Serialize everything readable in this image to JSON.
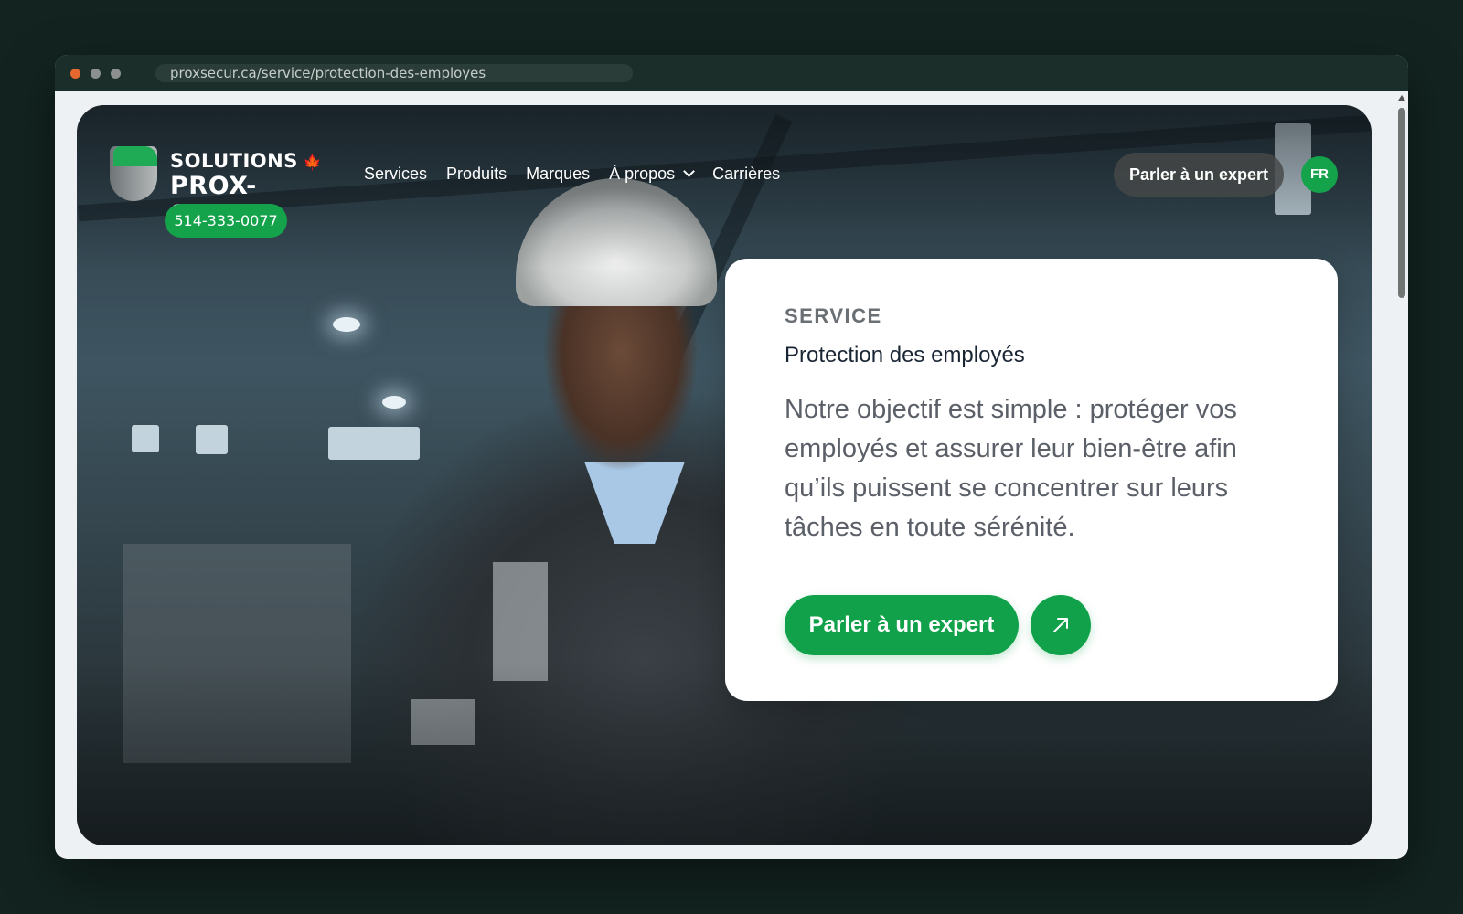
{
  "browser": {
    "url": "proxsecur.ca/service/protection-des-employes"
  },
  "header": {
    "logo_line1": "SOLUTIONS",
    "logo_line2": "PROX-SECUR",
    "phone": "514-333-0077",
    "nav": [
      {
        "label": "Services"
      },
      {
        "label": "Produits"
      },
      {
        "label": "Marques"
      },
      {
        "label": "À propos"
      },
      {
        "label": "Carrières"
      }
    ],
    "cta": "Parler à un expert",
    "lang": "FR"
  },
  "card": {
    "eyebrow": "SERVICE",
    "title": "Protection des employés",
    "body": "Notre objectif est simple : protéger vos employés et assurer leur bien-être afin qu’ils puissent se concentrer sur leurs tâches en toute sérénité.",
    "cta": "Parler à un expert"
  },
  "icons": {
    "logo": "shield-logo-icon",
    "leaf": "maple-leaf-icon",
    "dropdown": "chevron-down-icon",
    "arrow": "arrow-up-right-icon"
  },
  "colors": {
    "brand_green": "#14a34b",
    "page_bg": "#132420"
  }
}
